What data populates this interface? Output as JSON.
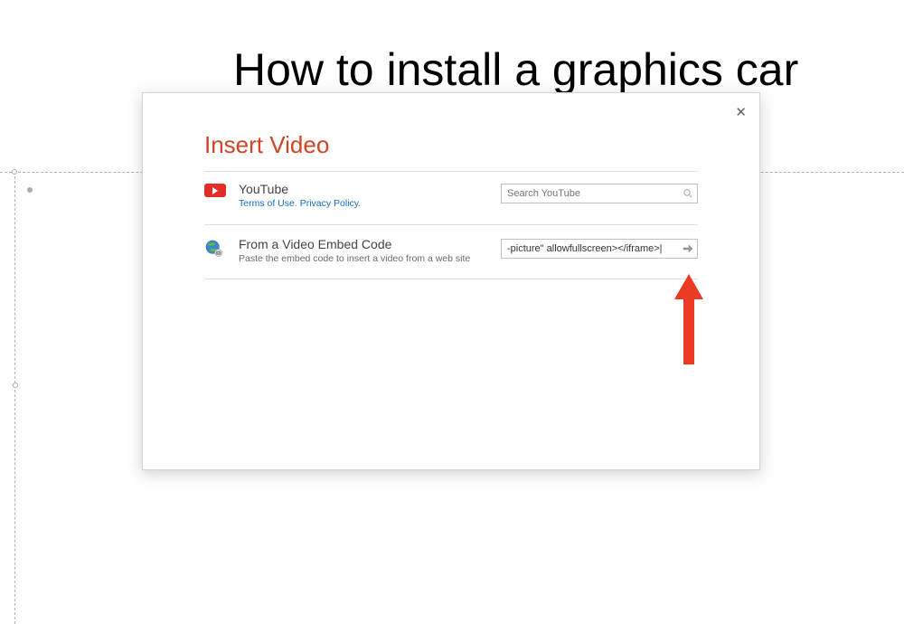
{
  "background": {
    "slide_title": "How to install a graphics car"
  },
  "dialog": {
    "title": "Insert Video",
    "close_label": "Close",
    "youtube": {
      "title": "YouTube",
      "terms": "Terms of Use",
      "sep": ". ",
      "privacy": "Privacy Policy",
      "end": ".",
      "placeholder": "Search YouTube"
    },
    "embed": {
      "title": "From a Video Embed Code",
      "desc": "Paste the embed code to insert a video from a web site",
      "value": "-picture\" allowfullscreen></iframe>|"
    }
  }
}
